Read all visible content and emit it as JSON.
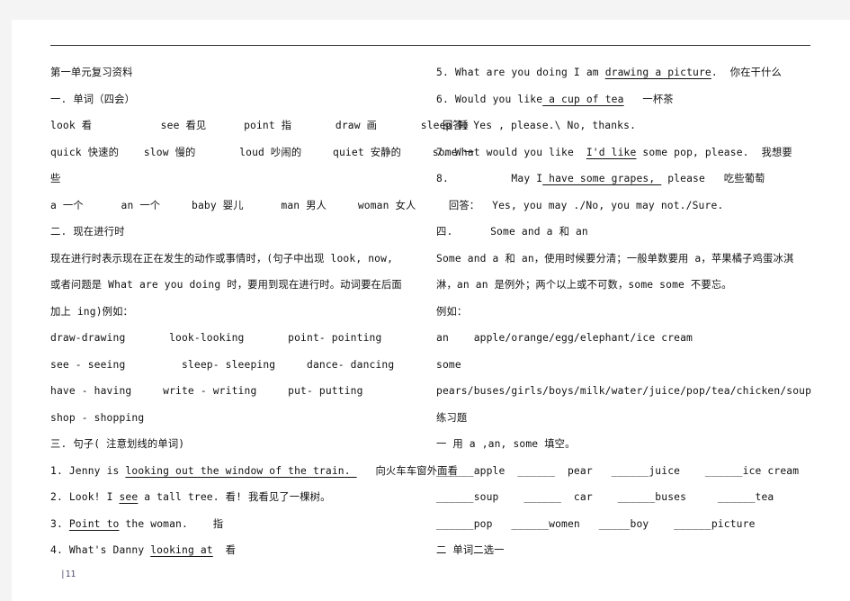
{
  "document": {
    "title": "第一单元复习资料",
    "page_marker": "|11"
  },
  "left_column": {
    "heading_title": "第一单元复习资料",
    "section_one_heading": "一. 单词（四会）",
    "vocab_rows": [
      "look 看           see 看见      point 指       draw 画       sleep 睡",
      "quick 快速的    slow 慢的       loud 吵闹的     quiet 安静的     some 一",
      "些",
      "a 一个      an 一个     baby 婴儿      man 男人     woman 女人"
    ],
    "section_two_heading": "二. 现在进行时",
    "section_two_body": "现在进行时表示现在正在发生的动作或事情时，(句子中出现 look, now,\n或者问题是 What are you doing 时，要用到现在进行时。动词要在后面\n加上 ing)例如：",
    "verb_rows": [
      "draw-drawing       look-looking       point- pointing",
      "see - seeing         sleep- sleeping     dance- dancing",
      "have - having     write - writing     put- putting",
      "shop - shopping"
    ],
    "section_three_heading": "三. 句子( 注意划线的单词)",
    "sentences": [
      {
        "number": "1.",
        "before": " Jenny is ",
        "underlined": "looking out the window of the train. ",
        "after": "   向火车车窗外面看"
      },
      {
        "number": "2.",
        "before": " Look! I ",
        "underlined": "see",
        "after": " a tall tree. 看! 我看见了一棵树。"
      },
      {
        "number": "3.",
        "before": " ",
        "underlined": "Point to",
        "after": " the woman.    指"
      },
      {
        "number": "4.",
        "before": " What's Danny ",
        "underlined": "looking at",
        "after": "  看"
      }
    ]
  },
  "right_column": {
    "sentences": [
      {
        "number": "5.",
        "before": " What are you doing I am ",
        "underlined": "drawing a picture",
        "after": ".  你在干什么"
      },
      {
        "number": "6.",
        "before": " Would you like",
        "underlined": " a cup of tea",
        "after": "   一杯茶"
      }
    ],
    "answer_line_1": " 回答：Yes , please.\\ No, thanks.",
    "sentence_seven": {
      "number": "7.",
      "before": " What would you like  ",
      "underlined": "I'd like",
      "after": " some pop, please.  我想要"
    },
    "sentence_eight": {
      "number": "8.",
      "before": "          May I",
      "underlined": " have some grapes, ",
      "after": " please   吃些葡萄"
    },
    "answer_line_2": "  回答：  Yes, you may ./No, you may not./Sure.",
    "section_four_heading": "四.      Some and a 和 an",
    "section_four_body": "Some and a 和 an，使用时候要分清；一般单数要用 a，苹果橘子鸡蛋冰淇\n淋，an an 是例外；两个以上或不可数，some some 不要忘。\n例如：",
    "example_an": "an    apple/orange/egg/elephant/ice cream",
    "example_some_label": "some",
    "example_some_list": "pears/buses/girls/boys/milk/water/juice/pop/tea/chicken/soup",
    "exercises_heading": "练习题",
    "exercise_one_heading": "一 用 a ,an, some 填空。",
    "blank_rows": [
      "______apple  ______  pear   ______juice    ______ice cream",
      "______soup    ______  car    ______buses     ______tea",
      "______pop   ______women   _____boy    ______picture"
    ],
    "exercise_two_heading": "二 单词二选一"
  }
}
